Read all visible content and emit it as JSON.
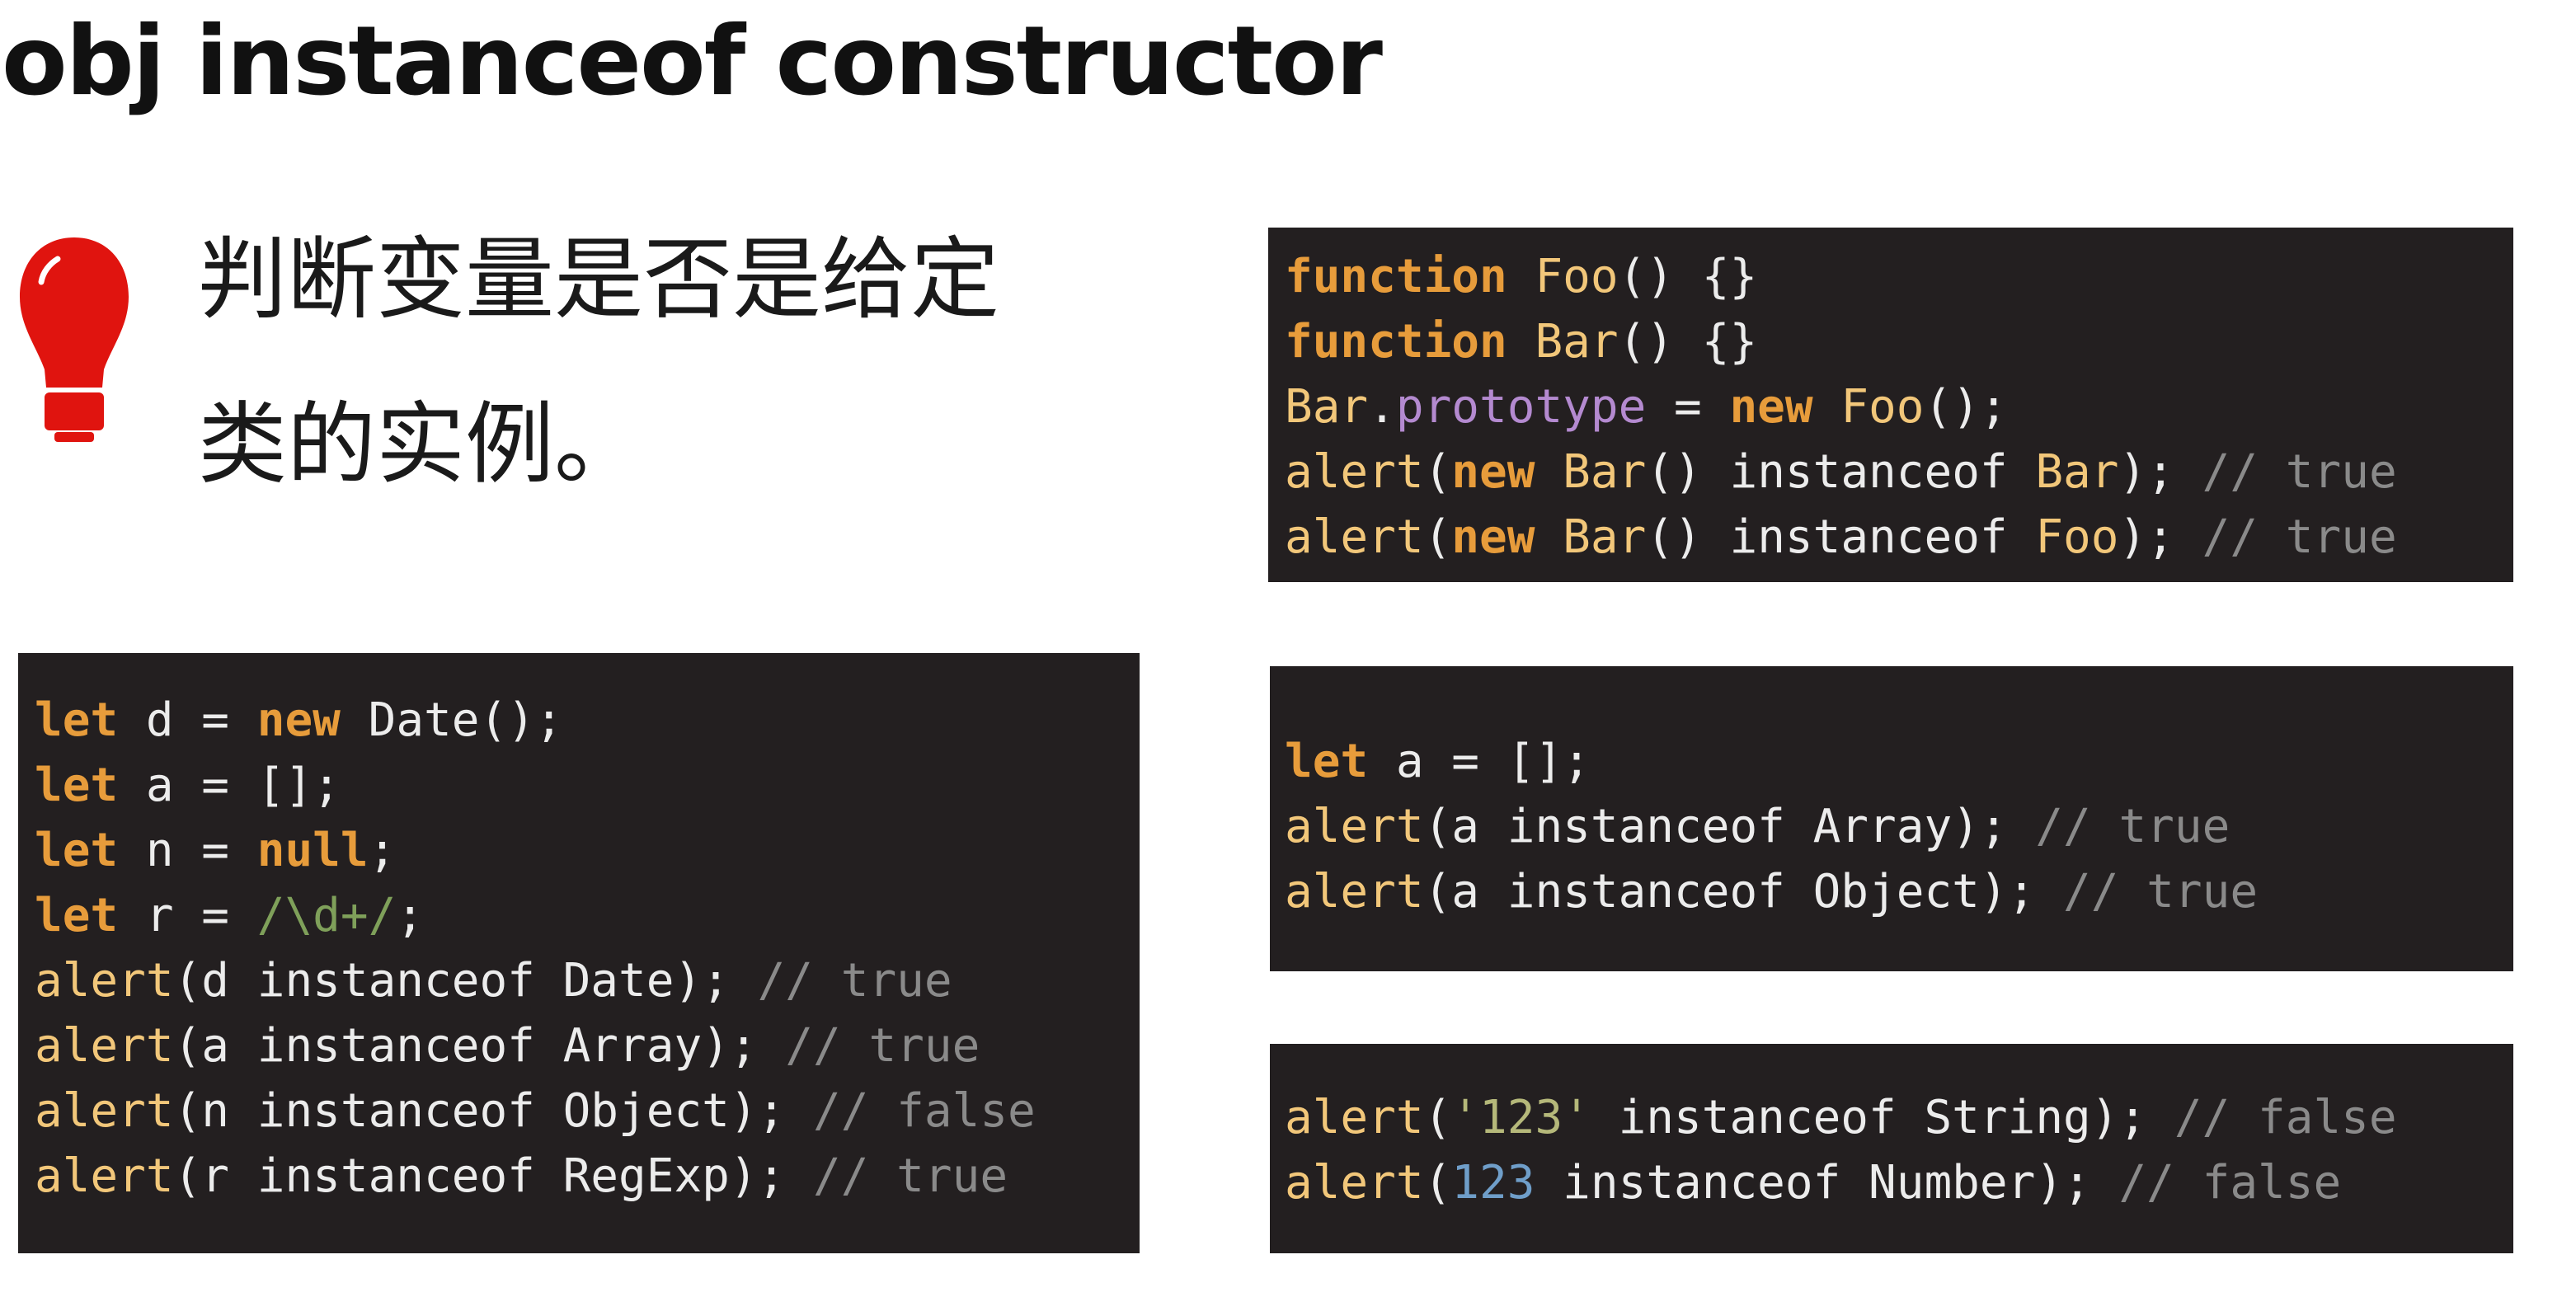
{
  "title": "obj instanceof constructor",
  "description": {
    "line1": "判断变量是否是给定",
    "line2": "类的实例。"
  },
  "colors": {
    "code_bg": "#231f20",
    "keyword": "#e79c3b",
    "function": "#f2c77a",
    "property": "#b48ad0",
    "comment": "#8a8a8a",
    "regex": "#7fa05a",
    "string": "#b5b87a",
    "number": "#6f9ec9",
    "bulb": "#e0140f"
  },
  "icon": "lightbulb-icon",
  "code_blocks": [
    {
      "name": "code-block-left",
      "lines": [
        [
          [
            "kw",
            "let"
          ],
          [
            "plain",
            " d = "
          ],
          [
            "kw",
            "new"
          ],
          [
            "plain",
            " Date();"
          ]
        ],
        [
          [
            "kw",
            "let"
          ],
          [
            "plain",
            " a = [];"
          ]
        ],
        [
          [
            "kw",
            "let"
          ],
          [
            "plain",
            " n = "
          ],
          [
            "kw",
            "null"
          ],
          [
            "plain",
            ";"
          ]
        ],
        [
          [
            "kw",
            "let"
          ],
          [
            "plain",
            " r = "
          ],
          [
            "re",
            "/\\d+/"
          ],
          [
            "plain",
            ";"
          ]
        ],
        [
          [
            "fn",
            "alert"
          ],
          [
            "plain",
            "(d instanceof Date); "
          ],
          [
            "cmt",
            "// true"
          ]
        ],
        [
          [
            "fn",
            "alert"
          ],
          [
            "plain",
            "(a instanceof Array); "
          ],
          [
            "cmt",
            "// true"
          ]
        ],
        [
          [
            "fn",
            "alert"
          ],
          [
            "plain",
            "(n instanceof Object); "
          ],
          [
            "cmt",
            "// false"
          ]
        ],
        [
          [
            "fn",
            "alert"
          ],
          [
            "plain",
            "(r instanceof RegExp); "
          ],
          [
            "cmt",
            "// true"
          ]
        ]
      ]
    },
    {
      "name": "code-block-prototype",
      "lines": [
        [
          [
            "kw",
            "function"
          ],
          [
            "plain",
            " "
          ],
          [
            "fn",
            "Foo"
          ],
          [
            "plain",
            "() {}"
          ]
        ],
        [
          [
            "kw",
            "function"
          ],
          [
            "plain",
            " "
          ],
          [
            "fn",
            "Bar"
          ],
          [
            "plain",
            "() {}"
          ]
        ],
        [
          [
            "cls",
            "Bar"
          ],
          [
            "plain",
            "."
          ],
          [
            "prop",
            "prototype"
          ],
          [
            "plain",
            " = "
          ],
          [
            "kw",
            "new"
          ],
          [
            "plain",
            " "
          ],
          [
            "cls",
            "Foo"
          ],
          [
            "plain",
            "();"
          ]
        ],
        [
          [
            "fn",
            "alert"
          ],
          [
            "plain",
            "("
          ],
          [
            "kw",
            "new"
          ],
          [
            "plain",
            " "
          ],
          [
            "cls",
            "Bar"
          ],
          [
            "plain",
            "() instanceof "
          ],
          [
            "cls",
            "Bar"
          ],
          [
            "plain",
            "); "
          ],
          [
            "cmt",
            "// true"
          ]
        ],
        [
          [
            "fn",
            "alert"
          ],
          [
            "plain",
            "("
          ],
          [
            "kw",
            "new"
          ],
          [
            "plain",
            " "
          ],
          [
            "cls",
            "Bar"
          ],
          [
            "plain",
            "() instanceof "
          ],
          [
            "cls",
            "Foo"
          ],
          [
            "plain",
            "); "
          ],
          [
            "cmt",
            "// true"
          ]
        ]
      ]
    },
    {
      "name": "code-block-array",
      "lines": [
        [
          [
            "kw",
            "let"
          ],
          [
            "plain",
            " a = [];"
          ]
        ],
        [
          [
            "fn",
            "alert"
          ],
          [
            "plain",
            "(a instanceof Array); "
          ],
          [
            "cmt",
            "// true"
          ]
        ],
        [
          [
            "fn",
            "alert"
          ],
          [
            "plain",
            "(a instanceof Object); "
          ],
          [
            "cmt",
            "// true"
          ]
        ]
      ]
    },
    {
      "name": "code-block-primitive",
      "lines": [
        [
          [
            "fn",
            "alert"
          ],
          [
            "plain",
            "("
          ],
          [
            "str",
            "'123'"
          ],
          [
            "plain",
            " instanceof String); "
          ],
          [
            "cmt",
            "// false"
          ]
        ],
        [
          [
            "fn",
            "alert"
          ],
          [
            "plain",
            "("
          ],
          [
            "num",
            "123"
          ],
          [
            "plain",
            " instanceof Number); "
          ],
          [
            "cmt",
            "// false"
          ]
        ]
      ]
    }
  ]
}
